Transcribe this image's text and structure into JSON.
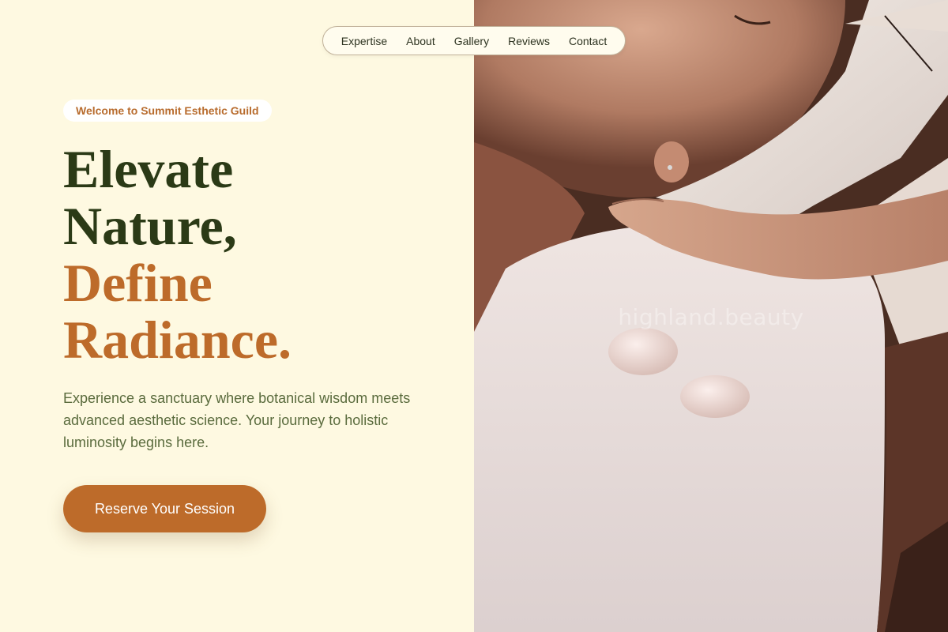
{
  "nav": {
    "items": [
      "Expertise",
      "About",
      "Gallery",
      "Reviews",
      "Contact"
    ]
  },
  "hero": {
    "badge": "Welcome to Summit Esthetic Guild",
    "headline": {
      "line1": "Elevate",
      "line2": "Nature,",
      "line3": "Define",
      "line4": "Radiance."
    },
    "subtext": "Experience a sanctuary where botanical wisdom meets advanced aesthetic science. Your journey to holistic luminosity begins here.",
    "cta_label": "Reserve Your Session"
  },
  "image": {
    "watermark": "highland.beauty"
  },
  "colors": {
    "background": "#fef9e1",
    "accent": "#bd6b2a",
    "headline_dark": "#2b3a16",
    "body_text": "#5a6b3d"
  }
}
